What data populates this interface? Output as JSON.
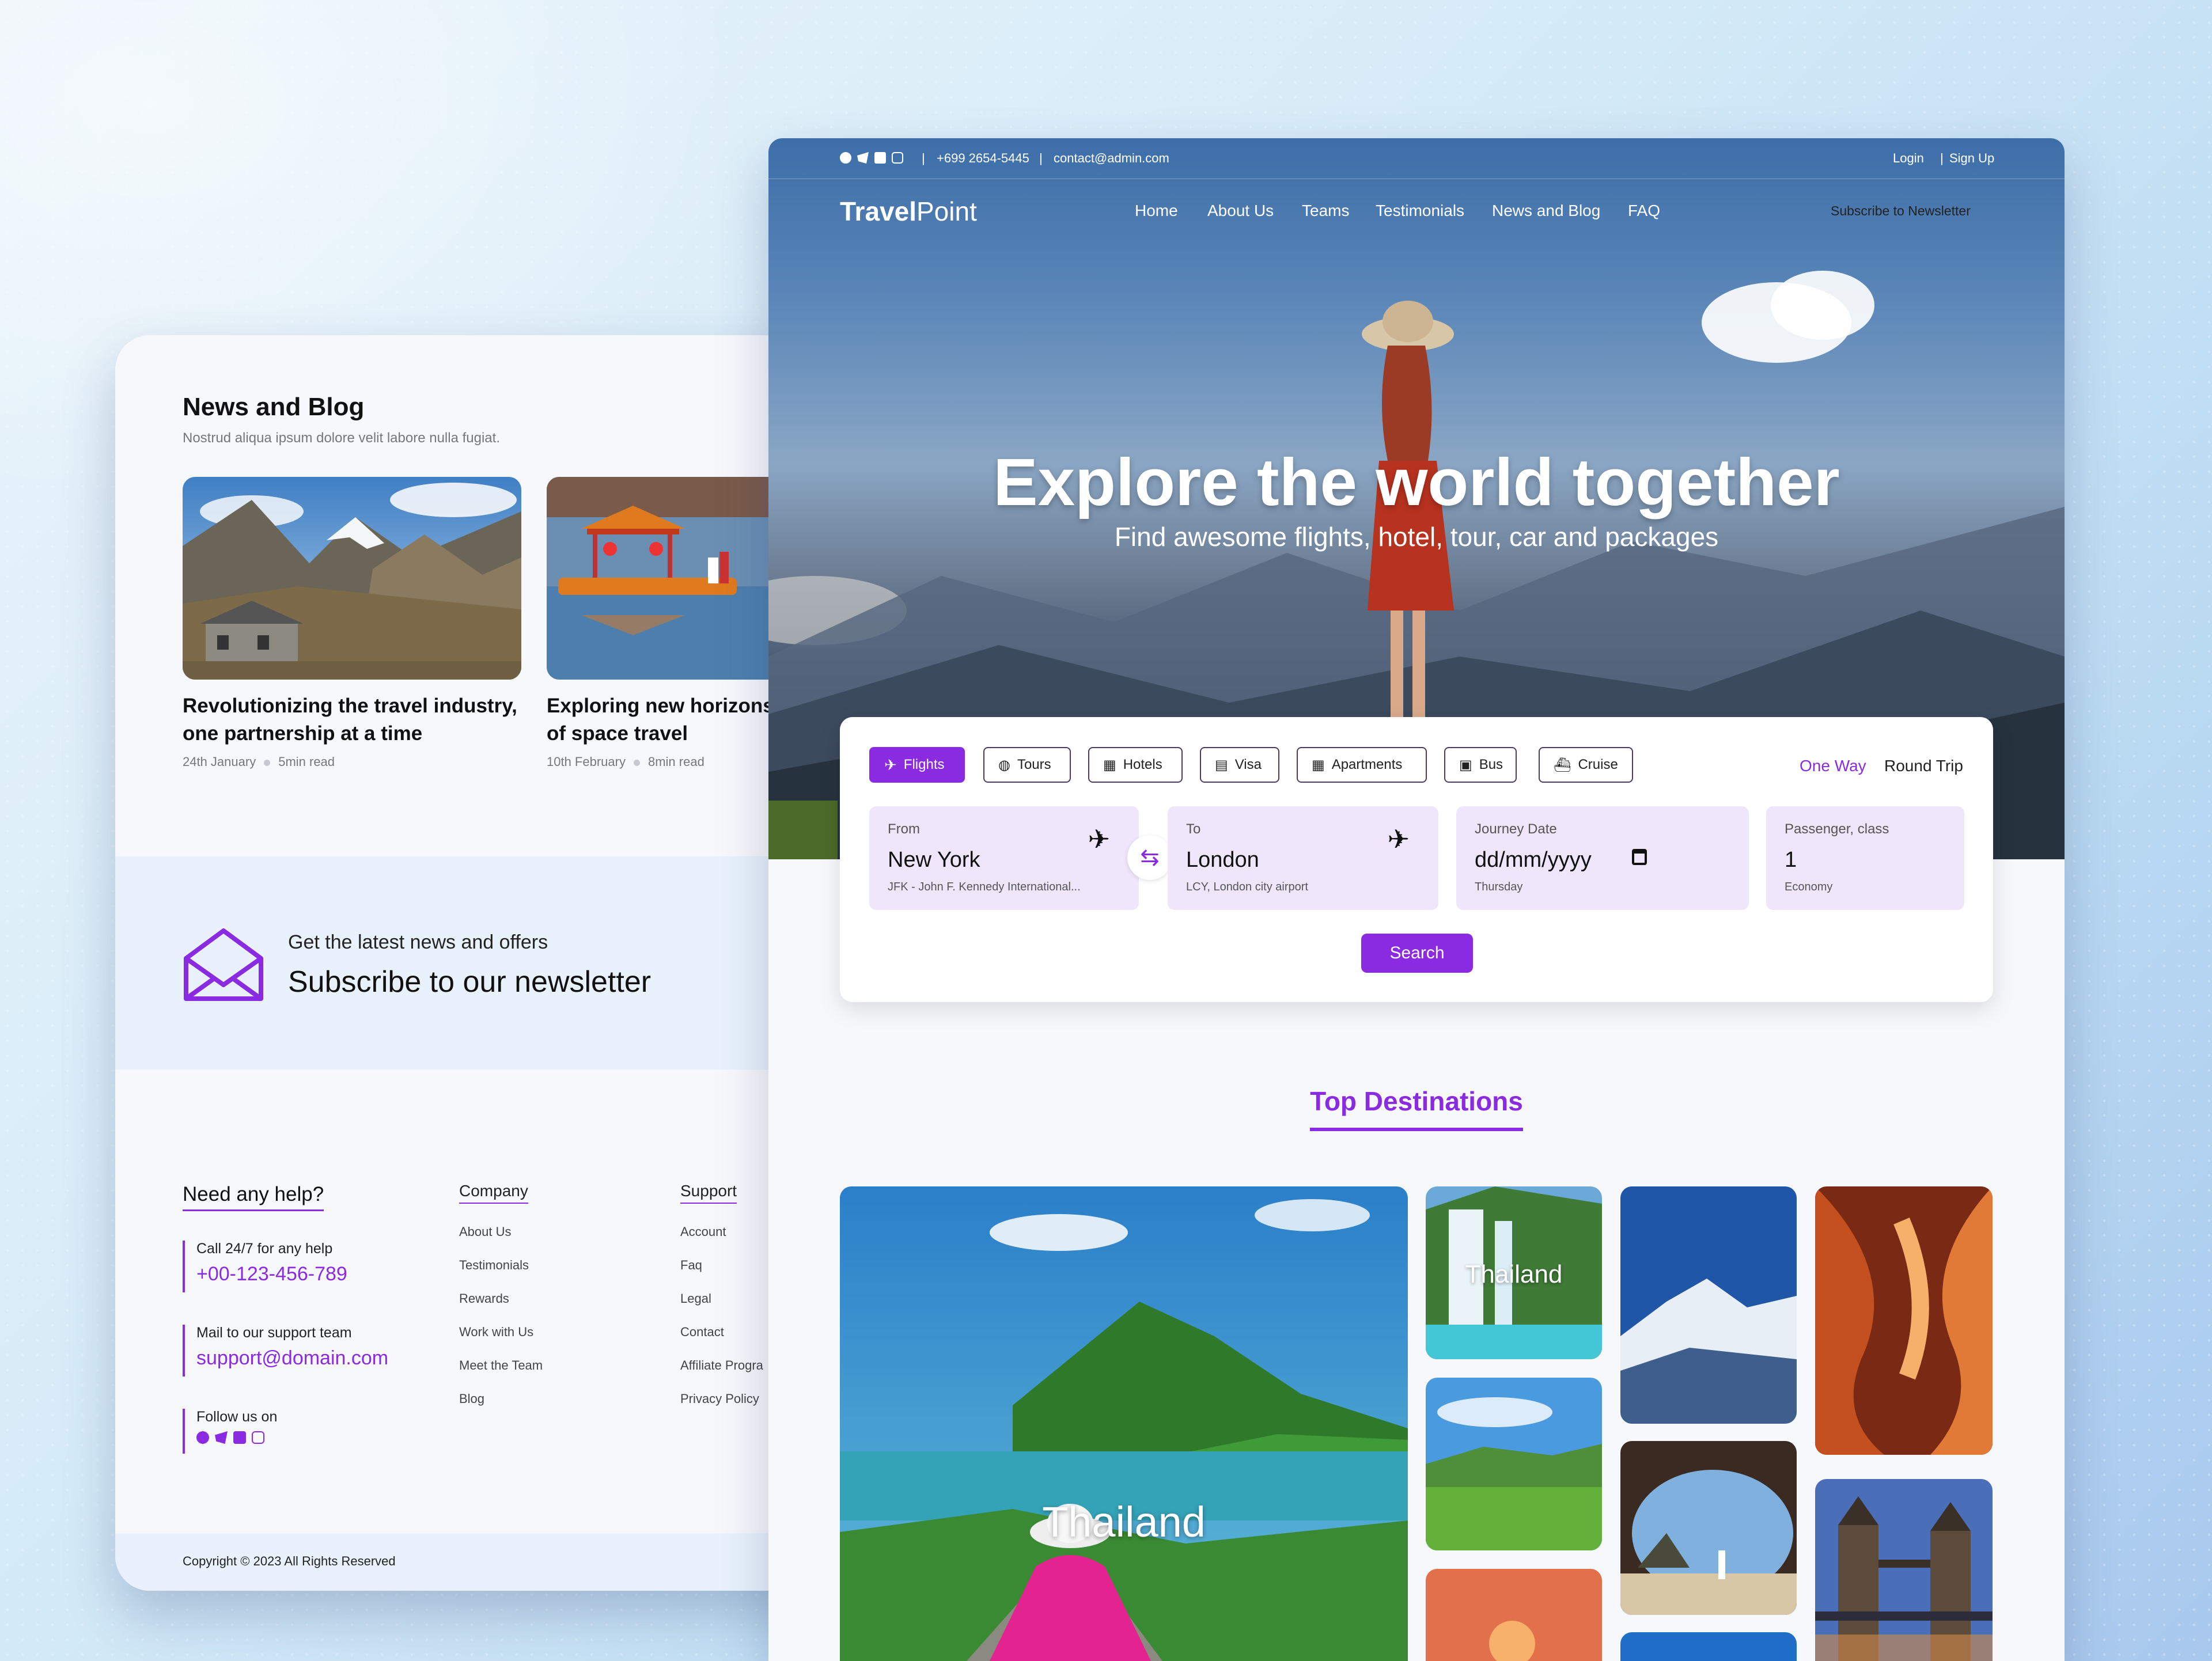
{
  "blog": {
    "title": "News and Blog",
    "subtitle": "Nostrud aliqua ipsum dolore velit labore nulla fugiat.",
    "posts": [
      {
        "title_l1": "Revolutionizing the travel industry,",
        "title_l2": "one partnership at a time",
        "date": "24th January",
        "read": "5min read"
      },
      {
        "title_l1": "Exploring new horizons",
        "title_l2": "of space travel",
        "date": "10th February",
        "read": "8min read"
      }
    ]
  },
  "newsletter": {
    "kicker": "Get the latest news and offers",
    "title": "Subscribe to our newsletter"
  },
  "footer": {
    "help_title": "Need any help?",
    "call_label": "Call 24/7 for any help",
    "phone": "+00-123-456-789",
    "mail_label": "Mail to our support team",
    "email": "support@domain.com",
    "follow_label": "Follow us on",
    "company_title": "Company",
    "company_links": [
      "About Us",
      "Testimonials",
      "Rewards",
      "Work with Us",
      "Meet the Team",
      "Blog"
    ],
    "support_title": "Support",
    "support_links": [
      "Account",
      "Faq",
      "Legal",
      "Contact",
      "Affiliate Progra",
      "Privacy Policy"
    ],
    "copyright": "Copyright © 2023 All Rights Reserved"
  },
  "topbar": {
    "phone": "+699 2654-5445",
    "email": "contact@admin.com",
    "login": "Login",
    "signup": "Sign Up",
    "sep": "|"
  },
  "brand": {
    "bold": "Travel",
    "light": "Point"
  },
  "nav": [
    "Home",
    "About Us",
    "Teams",
    "Testimonials",
    "News and Blog",
    "FAQ"
  ],
  "subscribe_link": "Subscribe to Newsletter",
  "hero": {
    "title": "Explore the world together",
    "subtitle": "Find awesome flights, hotel, tour, car and packages"
  },
  "search": {
    "tabs": [
      "Flights",
      "Tours",
      "Hotels",
      "Visa",
      "Apartments",
      "Bus",
      "Cruise"
    ],
    "trip_types": [
      "One Way",
      "Round Trip"
    ],
    "from": {
      "label": "From",
      "value": "New York",
      "detail": "JFK - John F. Kennedy International..."
    },
    "to": {
      "label": "To",
      "value": "London",
      "detail": "LCY, London city airport"
    },
    "date": {
      "label": "Journey Date",
      "value": "dd/mm/yyyy",
      "detail": "Thursday"
    },
    "passenger": {
      "label": "Passenger, class",
      "value": "1",
      "detail": "Economy"
    },
    "button": "Search"
  },
  "destinations": {
    "title": "Top Destinations",
    "main_label": "Thailand",
    "small_label": "Thailand"
  },
  "colors": {
    "accent": "#8a2be2",
    "heading": "#111111"
  }
}
